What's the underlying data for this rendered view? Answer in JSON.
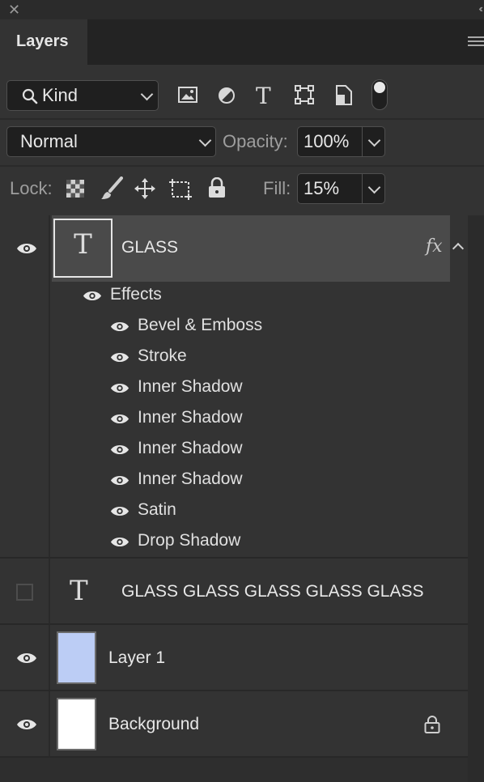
{
  "window": {
    "close_glyph": "✕",
    "collapse_glyph": "‹‹"
  },
  "panel": {
    "tab_label": "Layers"
  },
  "filter": {
    "kind_label": "Kind"
  },
  "blend": {
    "mode": "Normal",
    "opacity_label": "Opacity:",
    "opacity_value": "100%"
  },
  "lock": {
    "lock_label": "Lock:",
    "fill_label": "Fill:",
    "fill_value": "15%"
  },
  "layers": [
    {
      "name": "GLASS",
      "type": "text",
      "visible": true,
      "selected": true,
      "fx": "fx",
      "effects_label": "Effects",
      "effects": [
        "Bevel & Emboss",
        "Stroke",
        "Inner Shadow",
        "Inner Shadow",
        "Inner Shadow",
        "Inner Shadow",
        "Satin",
        "Drop Shadow"
      ]
    },
    {
      "name": "GLASS GLASS GLASS GLASS GLASS",
      "type": "text",
      "visible": false
    },
    {
      "name": "Layer 1",
      "type": "pixel",
      "visible": true,
      "thumb_color": "#bccdf5"
    },
    {
      "name": "Background",
      "type": "pixel",
      "visible": true,
      "locked": true,
      "thumb_color": "#ffffff"
    }
  ],
  "text_glyph": "T",
  "colors": {
    "panel_bg": "#333333",
    "selected_bg": "#4a4a4a",
    "field_bg": "#1f1f1f"
  }
}
